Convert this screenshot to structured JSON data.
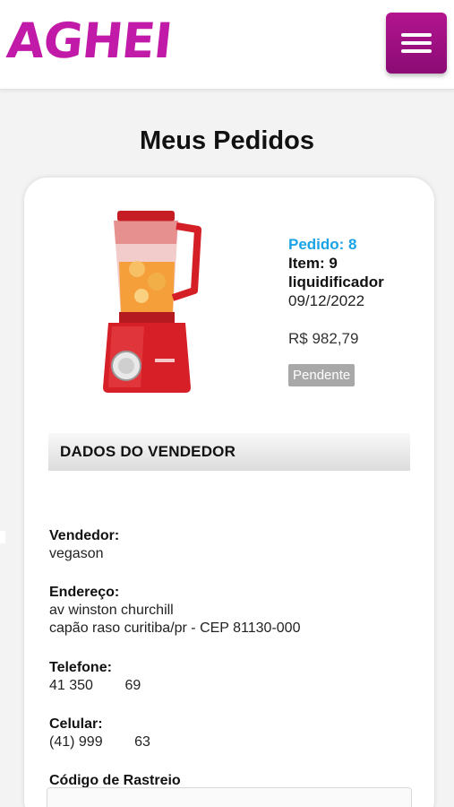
{
  "header": {
    "logo_text": "AGHEI",
    "menu_icon": "hamburger-menu-icon"
  },
  "page": {
    "title": "Meus Pedidos"
  },
  "order": {
    "number_label": "Pedido: 8",
    "item_label": "Item: 9",
    "product_name": "liquidificador",
    "date": "09/12/2022",
    "price": "R$ 982,79",
    "status": "Pendente",
    "product_image": "red-blender-product-image"
  },
  "seller": {
    "section_title": "DADOS DO VENDEDOR",
    "vendor_label": "Vendedor:",
    "vendor_value": "vegason",
    "address_label": "Endereço:",
    "address_line1": "av winston churchill",
    "address_line2": "capão raso curitiba/pr - CEP 81130-000",
    "phone_label": "Telefone:",
    "phone_value": "41 350        69",
    "mobile_label": "Celular:",
    "mobile_value": "(41) 999        63",
    "tracking_label": "Código de Rastreio",
    "tracking_value": ""
  },
  "colors": {
    "brand": "#c21aa8",
    "menu_button": "#a0127f",
    "order_number": "#1aa3e6",
    "status_badge": "#a8a8a8"
  }
}
